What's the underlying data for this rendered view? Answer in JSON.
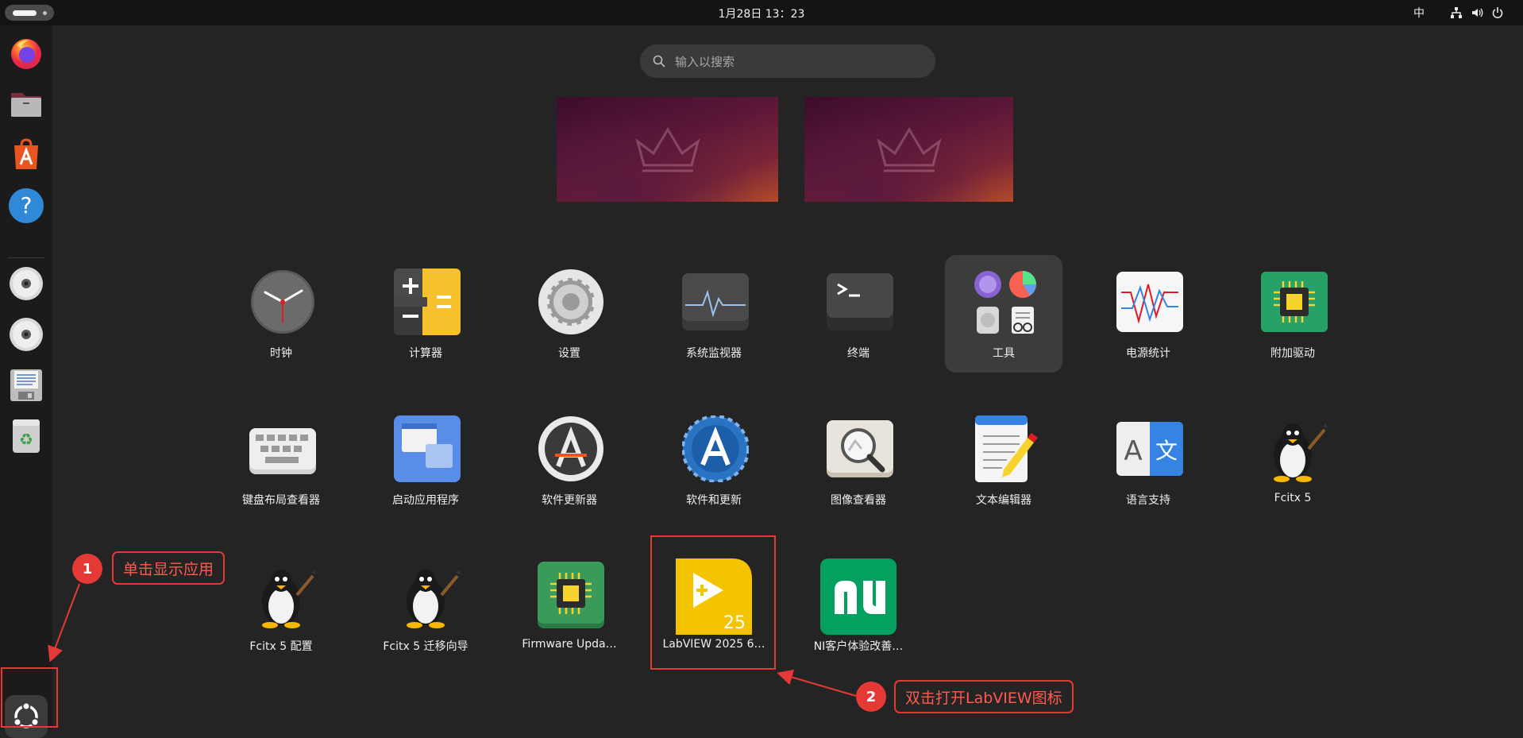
{
  "topbar": {
    "clock": "1月28日  13：23",
    "input_method": "中",
    "tray_icons": [
      "network-icon",
      "volume-icon",
      "power-icon"
    ]
  },
  "dock": {
    "items": [
      "firefox-icon",
      "files-icon",
      "app-center-icon",
      "help-icon",
      "disc-icon",
      "disc-icon",
      "floppy-icon",
      "trash-icon"
    ],
    "show_apps": "show-apps-icon"
  },
  "search": {
    "placeholder": "输入以搜索"
  },
  "apps": [
    {
      "label": "时钟",
      "icon": "clock-icon"
    },
    {
      "label": "计算器",
      "icon": "calculator-icon"
    },
    {
      "label": "设置",
      "icon": "settings-icon"
    },
    {
      "label": "系统监视器",
      "icon": "system-monitor-icon"
    },
    {
      "label": "终端",
      "icon": "terminal-icon"
    },
    {
      "label": "工具",
      "icon": "utilities-folder-icon"
    },
    {
      "label": "电源统计",
      "icon": "power-statistics-icon"
    },
    {
      "label": "附加驱动",
      "icon": "additional-drivers-icon"
    },
    {
      "label": "键盘布局查看器",
      "icon": "keyboard-layout-icon"
    },
    {
      "label": "启动应用程序",
      "icon": "startup-apps-icon"
    },
    {
      "label": "软件更新器",
      "icon": "software-updater-icon"
    },
    {
      "label": "软件和更新",
      "icon": "software-sources-icon"
    },
    {
      "label": "图像查看器",
      "icon": "image-viewer-icon"
    },
    {
      "label": "文本编辑器",
      "icon": "text-editor-icon"
    },
    {
      "label": "语言支持",
      "icon": "language-support-icon"
    },
    {
      "label": "Fcitx 5",
      "icon": "fcitx-penguin-icon"
    },
    {
      "label": "Fcitx 5 配置",
      "icon": "fcitx-penguin-icon"
    },
    {
      "label": "Fcitx 5 迁移向导",
      "icon": "fcitx-penguin-icon"
    },
    {
      "label": "Firmware Upda…",
      "icon": "firmware-chip-icon"
    },
    {
      "label": "LabVIEW 2025 6…",
      "icon": "labview-icon"
    },
    {
      "label": "NI客户体验改善…",
      "icon": "ni-icon"
    }
  ],
  "annotations": {
    "step1": {
      "number": "1",
      "text": "单击显示应用"
    },
    "step2": {
      "number": "2",
      "text": "双击打开LabVIEW图标"
    },
    "color": "#e53935"
  }
}
